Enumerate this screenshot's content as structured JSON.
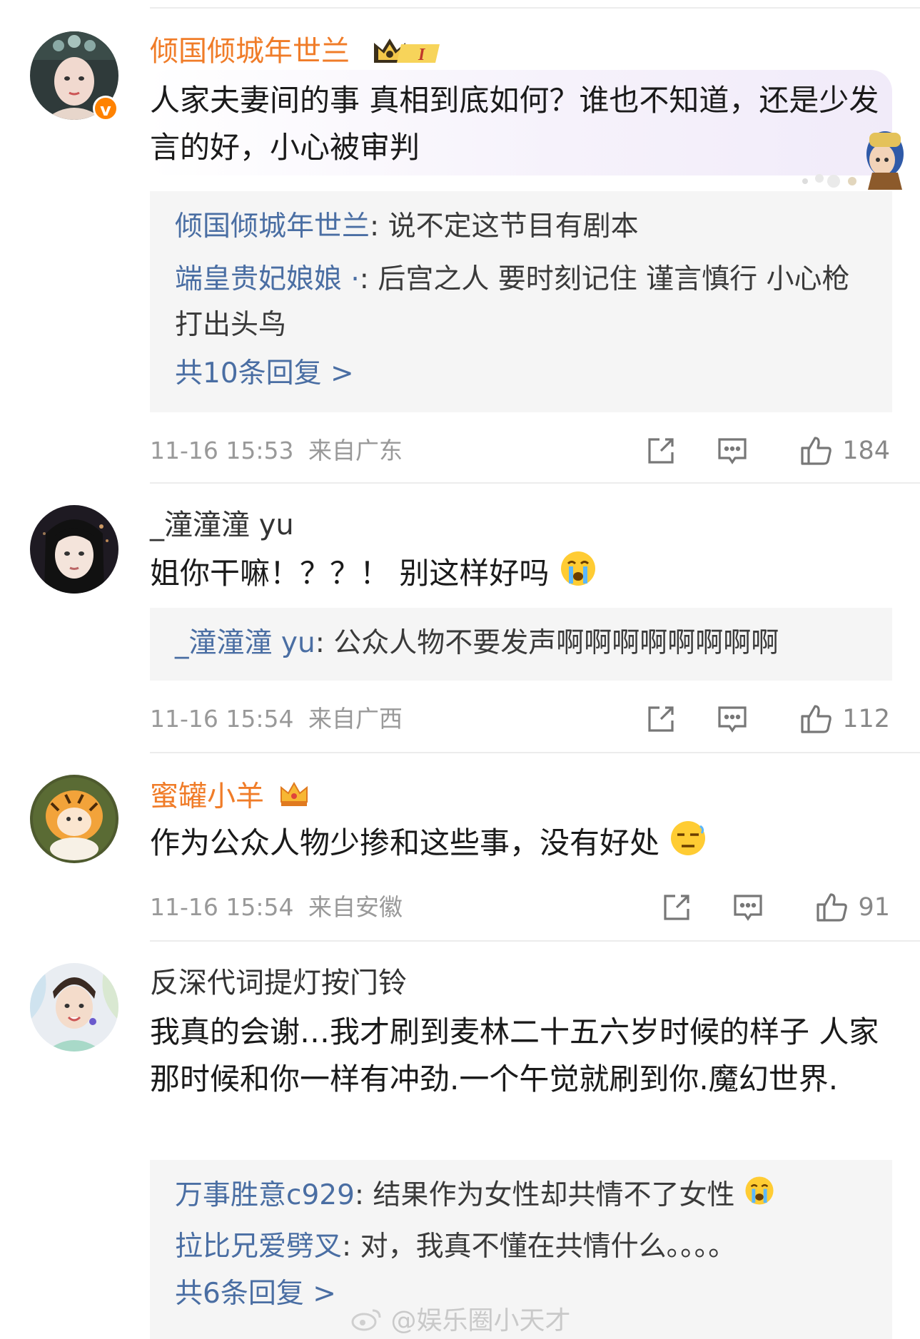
{
  "comments": [
    {
      "username": "倾国倾城年世兰",
      "text": "人家夫妻间的事 真相到底如何？谁也不知道，还是少发言的好，小心被审判",
      "replies": [
        {
          "name": "倾国倾城年世兰",
          "sep": ": ",
          "text": "说不定这节目有剧本"
        },
        {
          "name": "端皇贵妃娘娘 ·",
          "sep": ": ",
          "text": "后宫之人 要时刻记住 谨言慎行 小心枪打出头鸟"
        }
      ],
      "more_replies": "共10条回复 >",
      "time": "11-16 15:53",
      "location": "来自广东",
      "likes": "184",
      "badge_level": "I"
    },
    {
      "username": "_潼潼潼 yu",
      "text": "姐你干嘛！？？！ 别这样好吗",
      "replies": [
        {
          "name": "_潼潼潼 yu",
          "sep": ": ",
          "text": "公众人物不要发声啊啊啊啊啊啊啊啊"
        }
      ],
      "time": "11-16 15:54",
      "location": "来自广西",
      "likes": "112"
    },
    {
      "username": "蜜罐小羊",
      "text": "作为公众人物少掺和这些事，没有好处",
      "time": "11-16 15:54",
      "location": "来自安徽",
      "likes": "91"
    },
    {
      "username": "反深代词提灯按门铃",
      "text": "我真的会谢…我才刷到麦林二十五六岁时候的样子 人家那时候和你一样有冲劲.一个午觉就刷到你.魔幻世界.",
      "replies": [
        {
          "name": "万事胜意c929",
          "sep": ": ",
          "text": "结果作为女性却共情不了女性"
        },
        {
          "name": "拉比兄爱劈叉",
          "sep": ": ",
          "text": "对，我真不懂在共情什么。。。。"
        }
      ],
      "more_replies": "共6条回复 >"
    }
  ],
  "watermark": "@娱乐圈小天才",
  "icons": {
    "share": "share-icon",
    "comment": "comment-icon",
    "like": "thumbs-up-icon",
    "verified": "verified-v-icon",
    "crown": "crown-icon"
  },
  "colors": {
    "username_vip": "#f07c28",
    "reply_name": "#4a6ea3",
    "meta": "#999999",
    "verified": "#ff8200"
  }
}
